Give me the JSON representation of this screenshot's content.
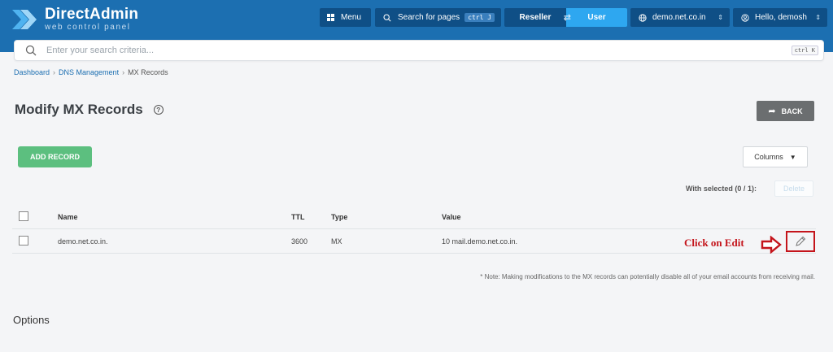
{
  "header": {
    "app_name": "DirectAdmin",
    "app_subtitle": "web control panel",
    "menu_label": "Menu",
    "search_pages_label": "Search for pages",
    "search_pages_kbd": "ctrl J",
    "reseller_label": "Reseller",
    "user_label": "User",
    "domain_label": "demo.net.co.in",
    "hello_label": "Hello, demosh"
  },
  "search": {
    "placeholder": "Enter your search criteria...",
    "kbd": "ctrl K"
  },
  "breadcrumb": {
    "items": [
      "Dashboard",
      "DNS Management",
      "MX Records"
    ]
  },
  "page": {
    "title": "Modify MX Records",
    "back_label": "BACK",
    "add_record_label": "ADD RECORD",
    "columns_label": "Columns",
    "with_selected_label": "With selected (0 / 1):",
    "delete_label": "Delete"
  },
  "table": {
    "headers": {
      "name": "Name",
      "ttl": "TTL",
      "type": "Type",
      "value": "Value"
    },
    "rows": [
      {
        "name": "demo.net.co.in.",
        "ttl": "3600",
        "type": "MX",
        "value": "10 mail.demo.net.co.in."
      }
    ]
  },
  "annotation": {
    "text": "Click on Edit",
    "color": "#c4141b"
  },
  "note": "* Note: Making modifications to the MX records can potentially disable all of your email accounts from receiving mail.",
  "options_heading": "Options",
  "colors": {
    "header_bg": "#1c6fb1",
    "add_button": "#5cbf7f",
    "user_toggle": "#2ea7f0"
  },
  "icons": {
    "logo": "directadmin-chevron-logo",
    "menu": "grid-icon",
    "search": "search-icon",
    "globe": "globe-icon",
    "user": "user-circle-icon",
    "help": "help-circle-icon",
    "back": "share-arrow-icon",
    "edit": "pencil-icon"
  }
}
